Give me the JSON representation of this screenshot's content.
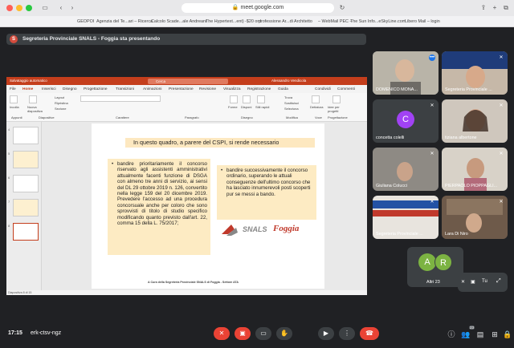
{
  "browser": {
    "url": "meet.google.com",
    "bookmarks": [
      "GEOPOI",
      "Agenzia del Te...ari – Ricerca",
      "Calcolo Scade...ale Andreani",
      "The Hypertext...ent) -$20 ord",
      "professione Ar...di Architetto",
      "– WebMail PEC –",
      "The Sun Info...eSkyLine.com",
      "Libero Mail – login"
    ]
  },
  "meet": {
    "presenter_initial": "S",
    "presenting_text": "Segreteria Provinciale SNALS - Foggia sta presentando",
    "meeting_time": "17:15",
    "meeting_code": "erk-ctsv-ngz",
    "participant_count": "23",
    "tiles": [
      {
        "name": "DOMENICO MONA...",
        "kind": "video"
      },
      {
        "name": "Segreteria Provinciale ...",
        "kind": "video"
      },
      {
        "name": "concetta colelli",
        "kind": "avatar",
        "initial": "C",
        "color": "#a142f4"
      },
      {
        "name": "tiziana albertone",
        "kind": "video"
      },
      {
        "name": "Giuliana Colucci",
        "kind": "video"
      },
      {
        "name": "PIERPAOLO PIOPPAGLI...",
        "kind": "video"
      },
      {
        "name": "Segreteria Provinciale ...",
        "kind": "video"
      },
      {
        "name": "Lara Di Niro",
        "kind": "video"
      }
    ],
    "others": {
      "label": "Altri 23",
      "initials": [
        "A",
        "R"
      ]
    },
    "self_label": "Tu"
  },
  "ppt": {
    "title_left": "Salvataggio automatico",
    "search": "Cerca",
    "user": "Alessandro Vendicola",
    "menu": [
      "File",
      "Home",
      "Inserisci",
      "Disegno",
      "Progettazione",
      "Transizioni",
      "Animazioni",
      "Presentazione",
      "Revisione",
      "Visualizza",
      "Registrazione",
      "Guida"
    ],
    "menu_right": [
      "Condividi",
      "Commenti"
    ],
    "ribbon_labels": [
      "Incolla",
      "Appunti",
      "Nuova diapositiva",
      "Layout",
      "Ripristina",
      "Sezione",
      "Diapositive",
      "Carattere",
      "Paragrafo",
      "Forme",
      "Disponi",
      "Stili rapidi",
      "Disegno",
      "Trova",
      "Sostituisci",
      "Seleziona",
      "Modifica",
      "Dettatura",
      "Voce",
      "Idee per progetti",
      "Progettazione"
    ],
    "status": "Diapositiva 8 di 15",
    "slide": {
      "heading": "In questo quadro, a parere del CSPI, si rende necessario",
      "left_text": "bandire prioritariamente il concorso riservato agli assistenti amministrativi attualmente facenti funzione di DSGA con almeno tre anni di servizio, ai sensi del DL 29 ottobre 2019 n. 126, convertito nella legge 159 del 20 dicembre 2019. Prevedere l'accesso ad una procedura concorsuale anche per coloro che sono sprovvisti di titolo di studio specifico modificando quanto previsto dall'art. 22, comma 15 della L. 75/2017;",
      "right_text": "bandire successivamente il concorso ordinario, superando le attuali conseguenze dell'ultimo concorso che ha lasciato innumerevoli posti scoperti pur se messi a bando.",
      "logo_text": "SNALS",
      "logo_city": "Foggia",
      "footer": "A Cura della Segreteria Provinciale SNALS di Foggia - Settore ATA",
      "thumb_numbers": [
        "4",
        "5",
        "6",
        "7",
        "8"
      ]
    }
  }
}
